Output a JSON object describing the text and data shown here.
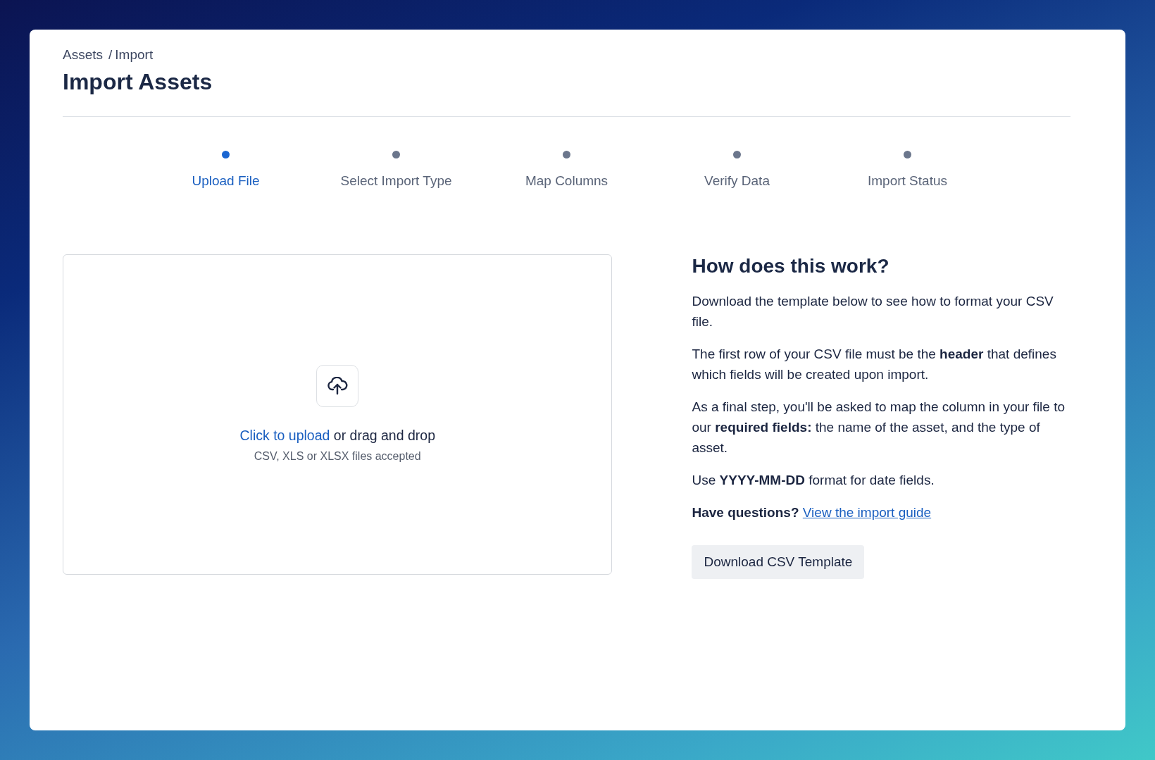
{
  "breadcrumb": {
    "items": [
      "Assets",
      "Import"
    ],
    "separator": "/"
  },
  "title": "Import Assets",
  "steps": [
    {
      "label": "Upload File",
      "selected": true
    },
    {
      "label": "Select Import Type",
      "selected": false
    },
    {
      "label": "Map Columns",
      "selected": false
    },
    {
      "label": "Verify Data",
      "selected": false
    },
    {
      "label": "Import Status",
      "selected": false
    }
  ],
  "upload": {
    "link": "Click to upload",
    "text": " or drag and drop",
    "hint": "CSV, XLS or XLSX files accepted"
  },
  "help": {
    "heading": "How does this work?",
    "paragraphs": [
      "Download the template below to see how to format your CSV file.",
      "The first row of your CSV file must be the **header** that defines which fields will be created upon import.",
      "As a final step, you'll be asked to map the column in your file to our **required fields:** the name of the asset, and the type of asset.",
      "Use **YYYY-MM-DD** format for date fields."
    ],
    "question": "**Have questions?** ",
    "link": "View the import guide",
    "button": "Download CSV Template"
  }
}
